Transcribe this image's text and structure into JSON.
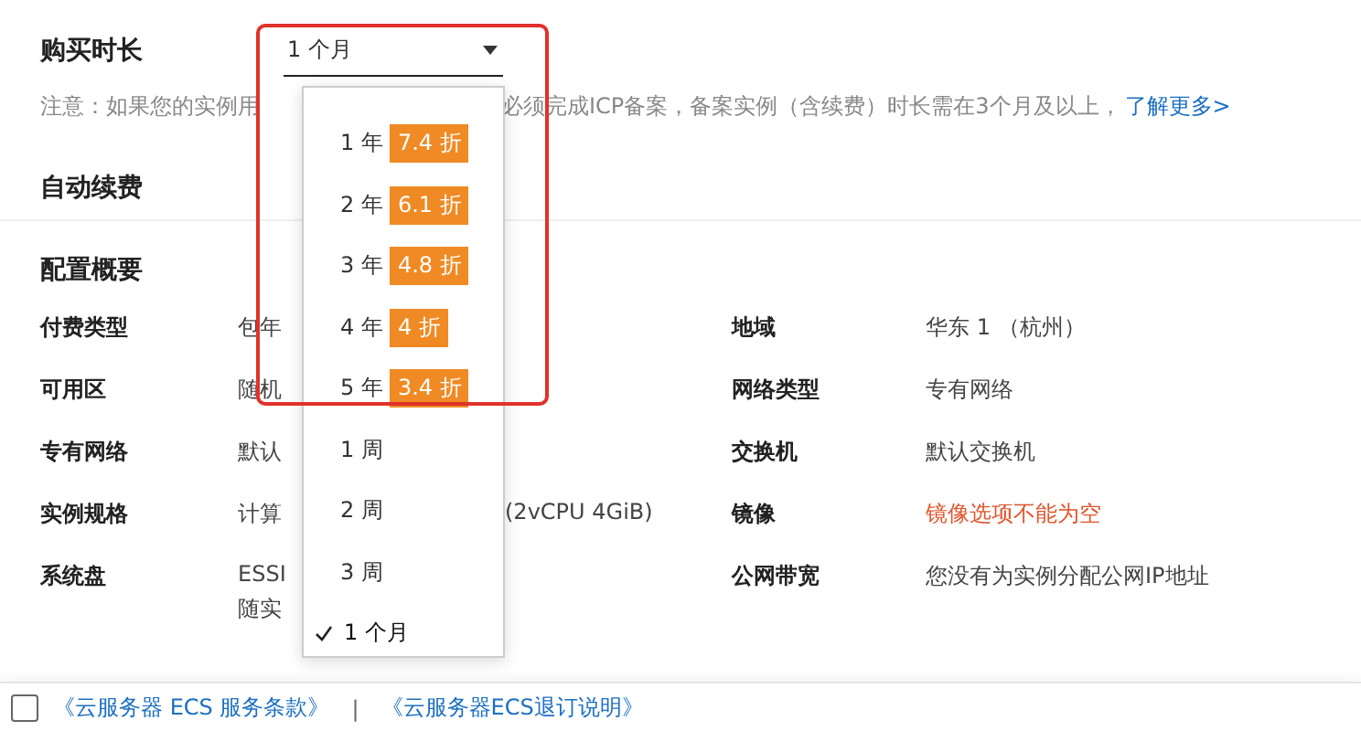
{
  "duration": {
    "label": "购买时长",
    "select": {
      "value": "1 个月",
      "expanded": true
    },
    "note": {
      "before": "注意：如果您的实例用",
      "after": "必须完成ICP备案，备案实例（含续费）时长需在3个月及以上，",
      "link": "了解更多>"
    },
    "options": [
      {
        "kind": "year",
        "label": "1 年",
        "discount": "7.4 折",
        "selected": false
      },
      {
        "kind": "year",
        "label": "2 年",
        "discount": "6.1 折",
        "selected": false
      },
      {
        "kind": "year",
        "label": "3 年",
        "discount": "4.8 折",
        "selected": false
      },
      {
        "kind": "year",
        "label": "4 年",
        "discount": "4 折",
        "selected": false
      },
      {
        "kind": "year",
        "label": "5 年",
        "discount": "3.4 折",
        "selected": false
      },
      {
        "kind": "plain",
        "label": "1 周",
        "selected": false
      },
      {
        "kind": "plain",
        "label": "2 周",
        "selected": false
      },
      {
        "kind": "plain",
        "label": "3 周",
        "selected": false
      },
      {
        "kind": "plain",
        "label": "1 个月",
        "selected": true
      }
    ]
  },
  "auto_renew": {
    "label": "自动续费"
  },
  "summary": {
    "title": "配置概要",
    "rows": [
      {
        "label": "付费类型",
        "value": "包年",
        "value_right": "",
        "label2": "地域",
        "value2": "华东 1 （杭州）",
        "kind": "normal"
      },
      {
        "label": "可用区",
        "value": "随机",
        "value_right": "",
        "label2": "网络类型",
        "value2": "专有网络",
        "kind": "normal"
      },
      {
        "label": "专有网络",
        "value": "默认",
        "value_right": "",
        "label2": "交换机",
        "value2": "默认交换机",
        "kind": "normal"
      },
      {
        "label": "实例规格",
        "value": "计算",
        "value_right": "(2vCPU 4GiB)",
        "label2": "镜像",
        "value2": "镜像选项不能为空",
        "kind": "error"
      },
      {
        "label": "系统盘",
        "value": "ESSI",
        "value_extra": "随实",
        "value_right": "",
        "label2": "公网带宽",
        "value2": "您没有为实例分配公网IP地址",
        "kind": "normal"
      }
    ]
  },
  "footer": {
    "checked": false,
    "links": [
      "《云服务器 ECS 服务条款》",
      "《云服务器ECS退订说明》"
    ],
    "separator": "|"
  }
}
